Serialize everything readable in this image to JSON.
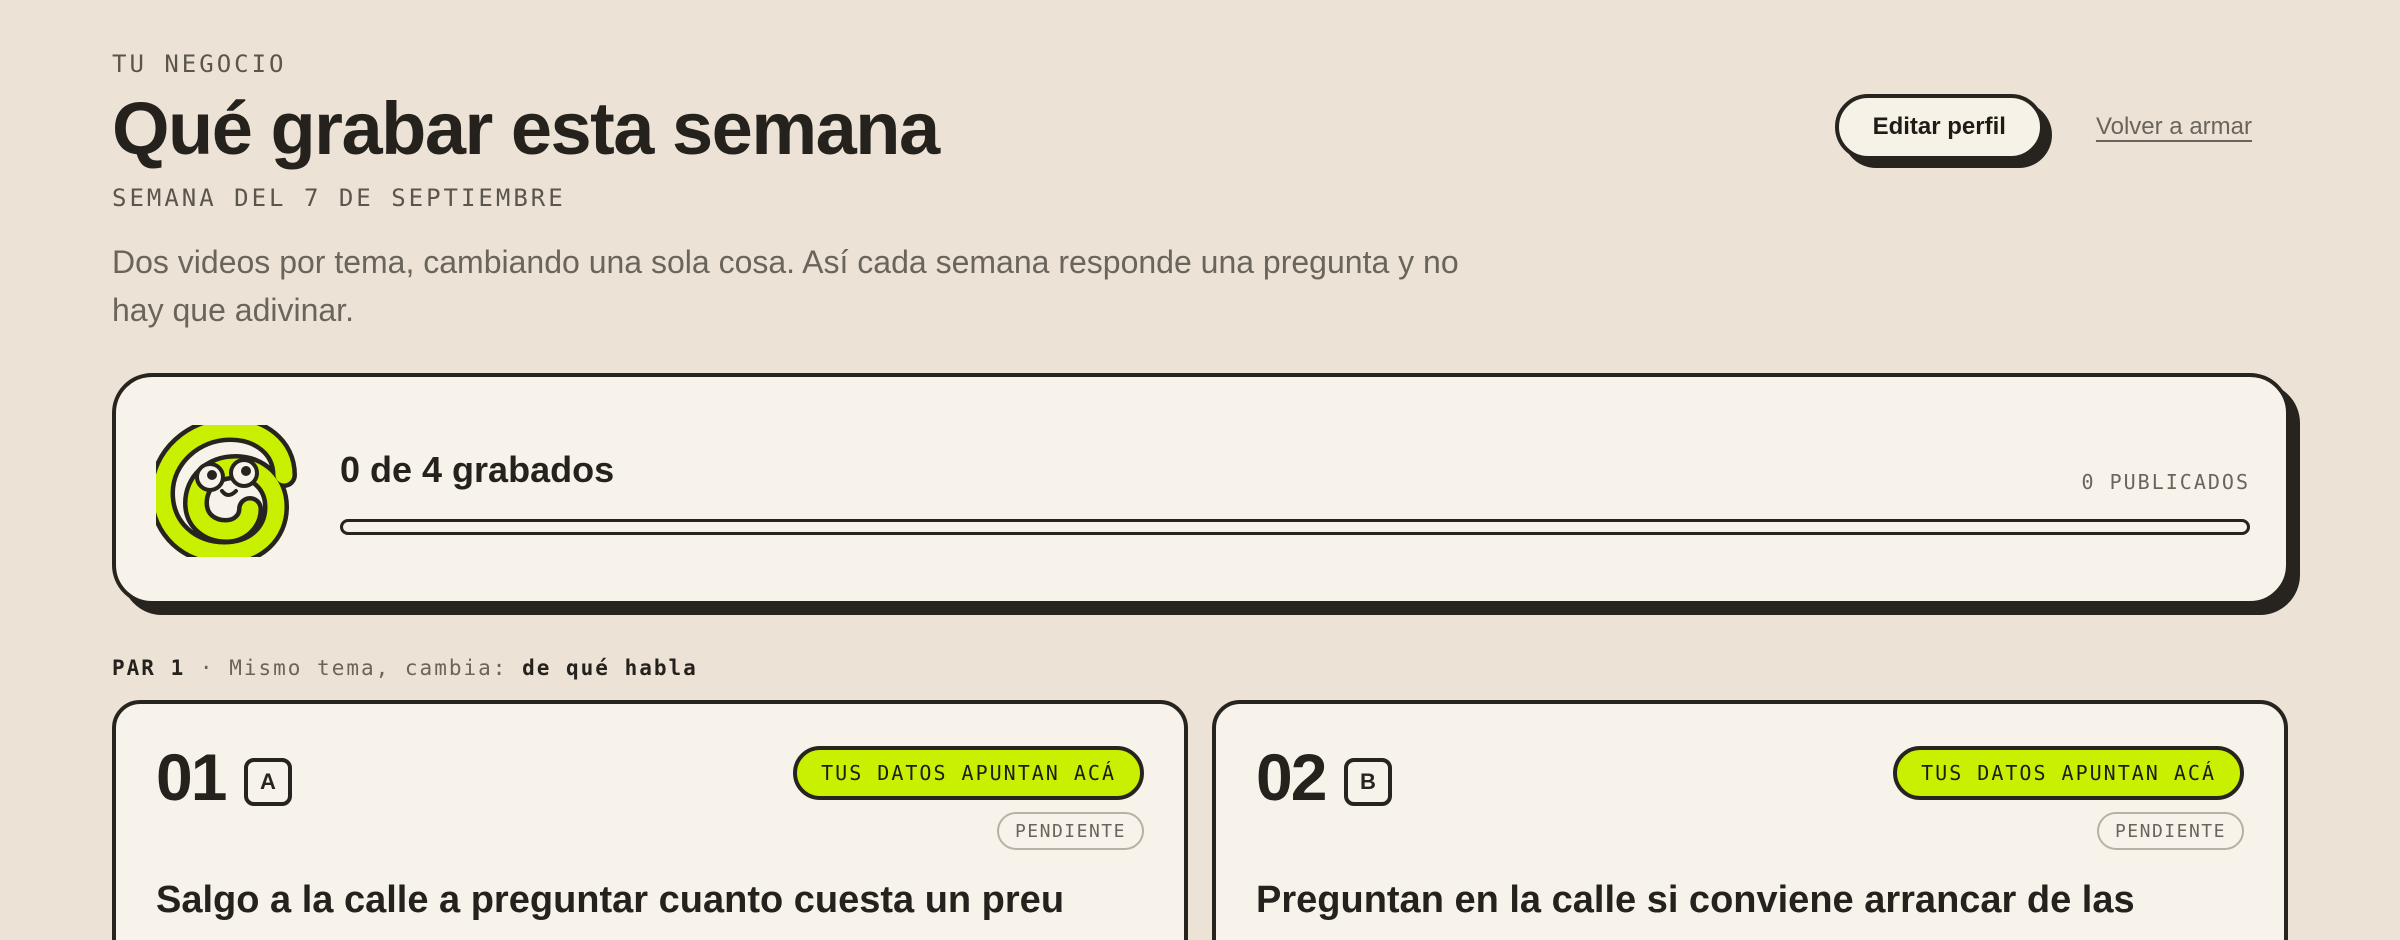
{
  "header": {
    "eyebrow": "TU NEGOCIO",
    "title": "Qué grabar esta semana",
    "week": "SEMANA DEL 7 DE SEPTIEMBRE",
    "description": "Dos videos por tema, cambiando una sola cosa. Así cada semana responde una pregunta y no hay que adivinar."
  },
  "actions": {
    "edit_profile": "Editar perfil",
    "back_link": "Volver a armar"
  },
  "progress": {
    "title": "0 de 4 grabados",
    "published": "0 PUBLICADOS",
    "recorded": 0,
    "total": 4
  },
  "pair": {
    "label": "PAR 1",
    "separator": "·",
    "text": "Mismo tema, cambia:",
    "variable": "de qué habla"
  },
  "cards": [
    {
      "number": "01",
      "letter": "A",
      "tag": "TUS DATOS APUNTAN ACÁ",
      "status": "PENDIENTE",
      "title": "Salgo a la calle a preguntar cuanto cuesta un preu"
    },
    {
      "number": "02",
      "letter": "B",
      "tag": "TUS DATOS APUNTAN ACÁ",
      "status": "PENDIENTE",
      "title": "Preguntan en la calle si conviene arrancar de las"
    }
  ],
  "colors": {
    "background": "#ece3d6",
    "card": "#f7f3ea",
    "ink": "#27241f",
    "accent": "#c8f000"
  },
  "icons": {
    "mascot": "snail-mascot-icon"
  }
}
